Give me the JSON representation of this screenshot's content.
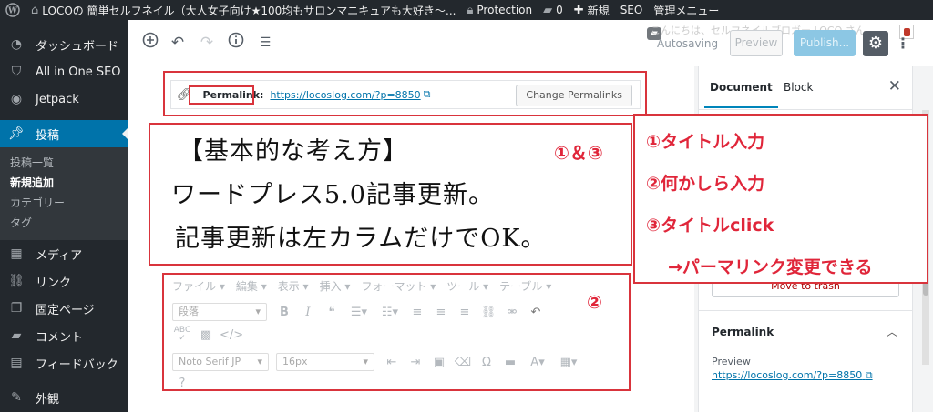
{
  "admin_bar": {
    "site_title": "LOCOの 簡単セルフネイル（大人女子向け★100均もサロンマニキュアも大好き～...",
    "protection": "Protection",
    "comments_count": "0",
    "new_label": "新規",
    "seo_label": "SEO",
    "admin_menu_label": "管理メニュー"
  },
  "sidebar": {
    "items": [
      {
        "label": "ダッシュボード",
        "icon": "dashboard-icon"
      },
      {
        "label": "All in One SEO",
        "icon": "shield-icon"
      },
      {
        "label": "Jetpack",
        "icon": "jetpack-icon"
      },
      {
        "label": "投稿",
        "icon": "pin-icon"
      }
    ],
    "submenu": [
      "投稿一覧",
      "新規追加",
      "カテゴリー",
      "タグ"
    ],
    "items_after": [
      {
        "label": "メディア",
        "icon": "media-icon"
      },
      {
        "label": "リンク",
        "icon": "link-icon"
      },
      {
        "label": "固定ページ",
        "icon": "page-icon"
      },
      {
        "label": "コメント",
        "icon": "comment-icon"
      },
      {
        "label": "フィードバック",
        "icon": "feedback-icon"
      },
      {
        "label": "外観",
        "icon": "appearance-icon"
      }
    ]
  },
  "header": {
    "greeting": "こんにちは、セルフネイルブロガー LOCO さん",
    "autosaving": "Autosaving",
    "preview": "Preview",
    "publish": "Publish..."
  },
  "permalink": {
    "label": "Permalink:",
    "url": "https://locoslog.com/?p=8850",
    "change_button": "Change Permalinks"
  },
  "post_title": {
    "lines": [
      "【基本的な考え方】",
      "ワードプレス5.0記事更新。",
      "記事更新は左カラムだけでOK。"
    ]
  },
  "classic_editor": {
    "menus": [
      "ファイル",
      "編集",
      "表示",
      "挿入",
      "フォーマット",
      "ツール",
      "テーブル"
    ],
    "paragraph_select": "段落",
    "font_select": "Noto Serif JP",
    "size_select": "16px"
  },
  "panel": {
    "tab_document": "Document",
    "tab_block": "Block",
    "move_to_trash": "Move to trash",
    "permalink_heading": "Permalink",
    "preview_label": "Preview",
    "preview_url": "https://locoslog.com/?p=8850"
  },
  "annotations": {
    "circle_13": "①＆③",
    "circle_2": "②",
    "notes": [
      "①タイトル入力",
      "②何かしら入力",
      "③タイトルclick",
      "→パーマリンク変更できる"
    ]
  },
  "colors": {
    "admin_bg": "#23282d",
    "accent": "#0073aa",
    "annotation_red": "#e0263a"
  }
}
